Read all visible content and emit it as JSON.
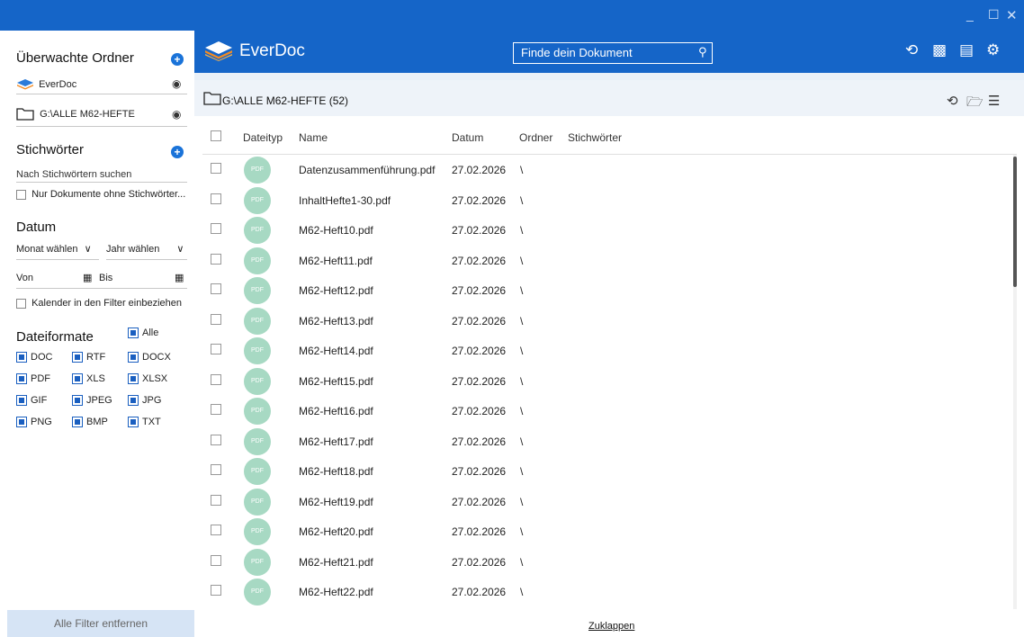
{
  "window": {
    "controls": {
      "minimize": "_",
      "maximize": "☐",
      "close": "✕"
    }
  },
  "colors": {
    "accent": "#1565c8",
    "badge": "#a7d9c3",
    "checkbox": "#1a5fc0"
  },
  "sidebar": {
    "watched_title": "Überwachte Ordner",
    "folders": [
      {
        "label": "EverDoc"
      },
      {
        "label": "G:\\ALLE M62-HEFTE"
      }
    ],
    "keywords_title": "Stichwörter",
    "keyword_search_placeholder": "Nach Stichwörtern suchen",
    "no_keywords_label": "Nur Dokumente ohne Stichwörter...",
    "date_title": "Datum",
    "month_select": "Monat wählen",
    "year_select": "Jahr wählen",
    "from_label": "Von",
    "to_label": "Bis",
    "calendar_label": "Kalender in den Filter einbeziehen",
    "formats_title": "Dateiformate",
    "formats_all": "Alle",
    "formats": [
      "DOC",
      "RTF",
      "DOCX",
      "PDF",
      "XLS",
      "XLSX",
      "GIF",
      "JPEG",
      "JPG",
      "PNG",
      "BMP",
      "TXT"
    ],
    "clear_filters": "Alle Filter entfernen"
  },
  "header": {
    "brand": "EverDoc",
    "search_placeholder": "Finde dein Dokument",
    "icons": [
      "sync-icon",
      "qr-code-icon",
      "scan-document-icon",
      "settings-icon"
    ]
  },
  "folder_bar": {
    "title": "G:\\ALLE M62-HEFTE (52)",
    "icons": [
      "sync-icon",
      "open-folder-icon",
      "filter-settings-icon"
    ]
  },
  "table": {
    "columns": {
      "type": "Dateityp",
      "name": "Name",
      "date": "Datum",
      "folder": "Ordner",
      "keywords": "Stichwörter"
    },
    "badge": "PDF",
    "rows": [
      {
        "name": "Datenzusammenführung.pdf",
        "date": "27.02.2026",
        "folder": "\\"
      },
      {
        "name": "InhaltHefte1-30.pdf",
        "date": "27.02.2026",
        "folder": "\\"
      },
      {
        "name": "M62-Heft10.pdf",
        "date": "27.02.2026",
        "folder": "\\"
      },
      {
        "name": "M62-Heft11.pdf",
        "date": "27.02.2026",
        "folder": "\\"
      },
      {
        "name": "M62-Heft12.pdf",
        "date": "27.02.2026",
        "folder": "\\"
      },
      {
        "name": "M62-Heft13.pdf",
        "date": "27.02.2026",
        "folder": "\\"
      },
      {
        "name": "M62-Heft14.pdf",
        "date": "27.02.2026",
        "folder": "\\"
      },
      {
        "name": "M62-Heft15.pdf",
        "date": "27.02.2026",
        "folder": "\\"
      },
      {
        "name": "M62-Heft16.pdf",
        "date": "27.02.2026",
        "folder": "\\"
      },
      {
        "name": "M62-Heft17.pdf",
        "date": "27.02.2026",
        "folder": "\\"
      },
      {
        "name": "M62-Heft18.pdf",
        "date": "27.02.2026",
        "folder": "\\"
      },
      {
        "name": "M62-Heft19.pdf",
        "date": "27.02.2026",
        "folder": "\\"
      },
      {
        "name": "M62-Heft20.pdf",
        "date": "27.02.2026",
        "folder": "\\"
      },
      {
        "name": "M62-Heft21.pdf",
        "date": "27.02.2026",
        "folder": "\\"
      },
      {
        "name": "M62-Heft22.pdf",
        "date": "27.02.2026",
        "folder": "\\"
      }
    ],
    "collapse_label": "Zuklappen"
  }
}
